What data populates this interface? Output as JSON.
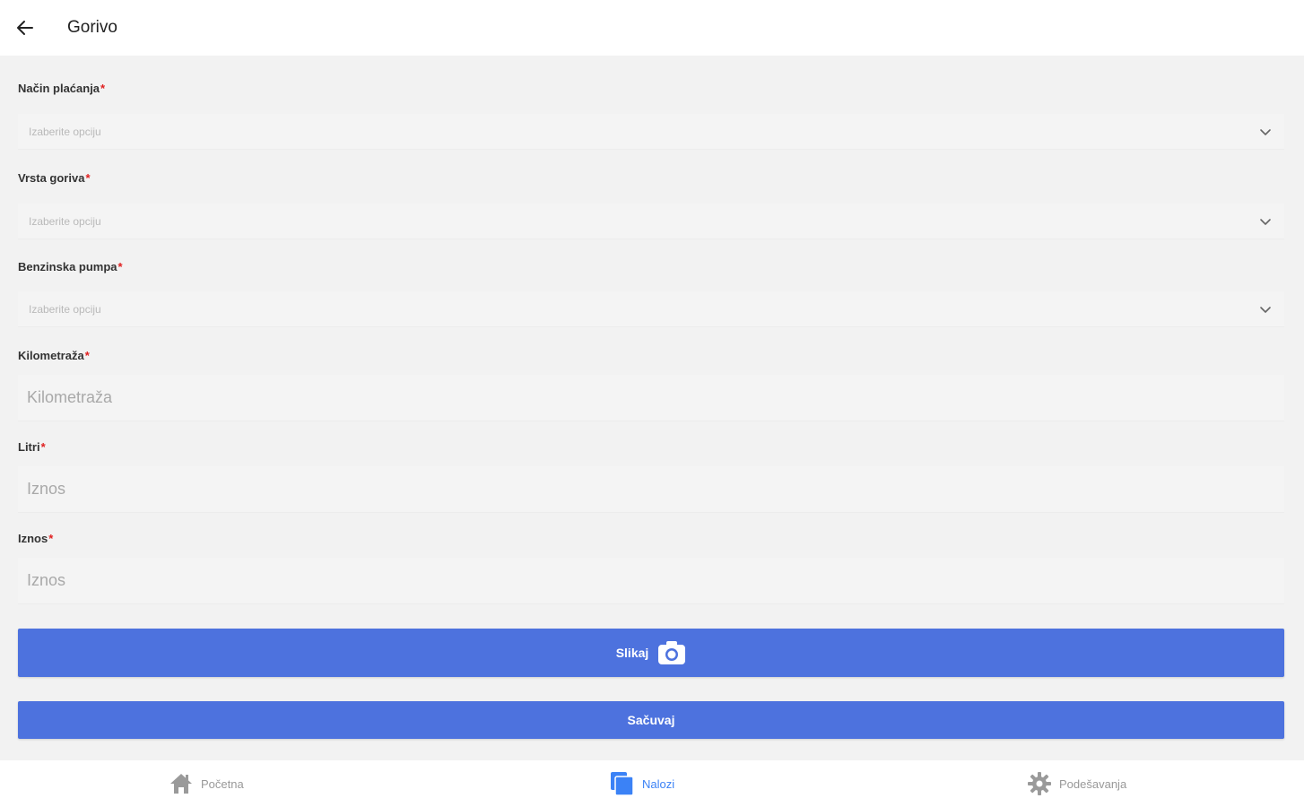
{
  "header": {
    "title": "Gorivo",
    "back_icon": "arrow-left-icon"
  },
  "form": {
    "payment_method": {
      "label": "Način plaćanja",
      "required_mark": "*",
      "placeholder": "Izaberite opciju"
    },
    "fuel_type": {
      "label": "Vrsta goriva",
      "required_mark": "*",
      "placeholder": "Izaberite opciju"
    },
    "gas_station": {
      "label": "Benzinska pumpa",
      "required_mark": "*",
      "placeholder": "Izaberite opciju"
    },
    "mileage": {
      "label": "Kilometraža",
      "required_mark": "*",
      "placeholder": "Kilometraža",
      "value": ""
    },
    "liters": {
      "label": "Litri",
      "required_mark": "*",
      "placeholder": "Iznos",
      "value": ""
    },
    "amount": {
      "label": "Iznos",
      "required_mark": "*",
      "placeholder": "Iznos",
      "value": ""
    },
    "photo_button": {
      "label": "Slikaj",
      "icon": "camera-icon"
    },
    "save_button": {
      "label": "Sačuvaj"
    }
  },
  "bottom_nav": {
    "items": [
      {
        "label": "Početna",
        "icon": "home-icon",
        "active": false
      },
      {
        "label": "Nalozi",
        "icon": "documents-icon",
        "active": true
      },
      {
        "label": "Podešavanja",
        "icon": "gear-icon",
        "active": false
      }
    ]
  },
  "colors": {
    "primary": "#4d72de",
    "active_nav": "#3b82f6",
    "required": "#e02020",
    "background": "#f2f2f2"
  }
}
